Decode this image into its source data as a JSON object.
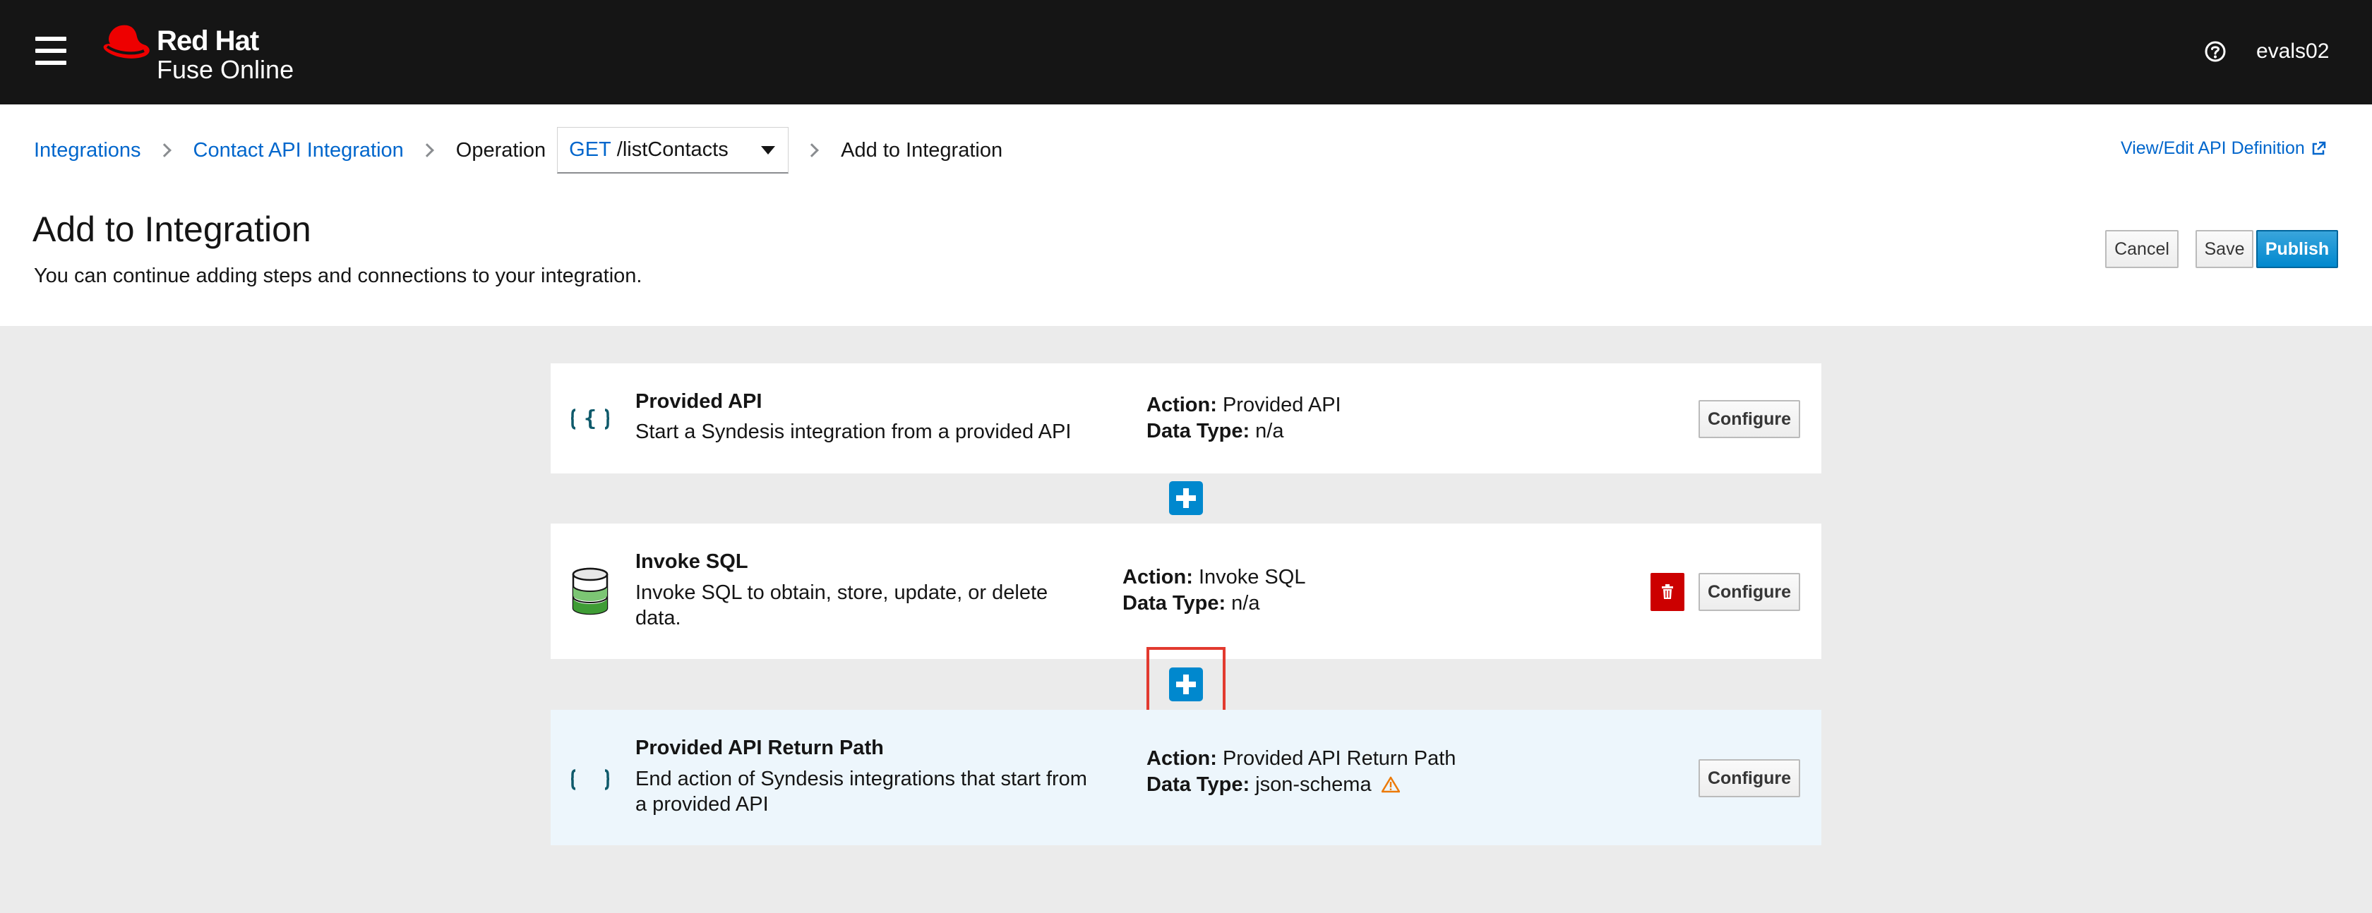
{
  "masthead": {
    "brand_line1": "Red Hat",
    "brand_line2": "Fuse Online",
    "help_icon": "question-circle-icon",
    "user": "evals02"
  },
  "breadcrumb": {
    "integrations": "Integrations",
    "integration": "Contact API Integration",
    "operation_label": "Operation",
    "operation_method": "GET",
    "operation_path": "/listContacts",
    "current": "Add to Integration"
  },
  "api_link": "View/Edit API Definition",
  "page": {
    "title": "Add to Integration",
    "subtitle": "You can continue adding steps and connections to your integration."
  },
  "actions": {
    "cancel": "Cancel",
    "save": "Save",
    "publish": "Publish"
  },
  "steps": [
    {
      "name": "Provided API",
      "description": "Start a Syndesis integration from a provided API",
      "action_label": "Action:",
      "action": "Provided API",
      "datatype_label": "Data Type:",
      "datatype": "n/a",
      "configure": "Configure",
      "icon": "api-braces-icon"
    },
    {
      "name": "Invoke SQL",
      "description": "Invoke SQL to obtain, store, update, or delete data.",
      "action_label": "Action:",
      "action": "Invoke SQL",
      "datatype_label": "Data Type:",
      "datatype": "n/a",
      "configure": "Configure",
      "icon": "database-icon"
    },
    {
      "name": "Provided API Return Path",
      "description": "End action of Syndesis integrations that start from a provided API",
      "action_label": "Action:",
      "action": "Provided API Return Path",
      "datatype_label": "Data Type:",
      "datatype": "json-schema",
      "configure": "Configure",
      "icon": "api-braces-icon"
    }
  ],
  "colors": {
    "masthead": "#151515",
    "link": "#0066cc",
    "primary": "#0088ce",
    "danger": "#cc0000",
    "warning": "#ec7a08",
    "highlight_row": "#edf6fc",
    "focus_box": "#e23a2f"
  }
}
